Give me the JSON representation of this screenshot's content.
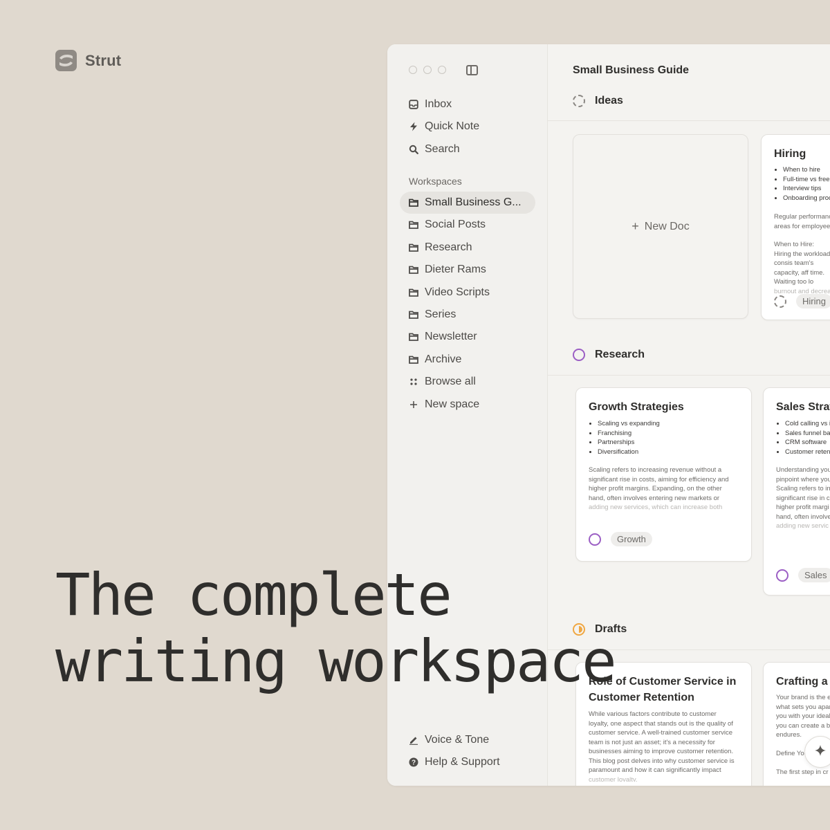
{
  "brand": {
    "name": "Strut"
  },
  "hero": {
    "line1": "The complete",
    "line2": "writing workspace"
  },
  "sidebar": {
    "top_items": [
      {
        "label": "Inbox",
        "icon": "inbox-icon"
      },
      {
        "label": "Quick Note",
        "icon": "bolt-icon"
      },
      {
        "label": "Search",
        "icon": "search-icon"
      }
    ],
    "section_label": "Workspaces",
    "workspaces": [
      {
        "label": "Small Business G...",
        "active": true
      },
      {
        "label": "Social Posts"
      },
      {
        "label": "Research"
      },
      {
        "label": "Dieter Rams"
      },
      {
        "label": "Video Scripts"
      },
      {
        "label": "Series"
      },
      {
        "label": "Newsletter"
      },
      {
        "label": "Archive"
      }
    ],
    "browse_all": "Browse all",
    "new_space": "New space",
    "bottom_items": [
      {
        "label": "Voice & Tone",
        "icon": "pen-icon"
      },
      {
        "label": "Help & Support",
        "icon": "help-icon"
      }
    ]
  },
  "main": {
    "title": "Small Business Guide",
    "groups": [
      {
        "label": "Ideas",
        "status": "dashed"
      },
      {
        "label": "Research",
        "status": "purple"
      },
      {
        "label": "Drafts",
        "status": "orange"
      }
    ],
    "new_doc": "New Doc",
    "cards": {
      "hiring": {
        "title": "Hiring",
        "bullets": [
          "When to hire",
          "Full-time vs free",
          "Interview tips",
          "Onboarding proc"
        ],
        "body1": "Regular performanc areas for employee",
        "body2": "When to Hire: Hiring the workload consis team's capacity, aff time. Waiting too lo",
        "faded": "burnout and decrea",
        "tag": "Hiring"
      },
      "growth": {
        "title": "Growth Strategies",
        "bullets": [
          "Scaling vs expanding",
          "Franchising",
          "Partnerships",
          "Diversification"
        ],
        "body": "Scaling refers to increasing revenue without a significant rise in costs, aiming for efficiency and higher profit margins. Expanding, on the other hand, often involves entering new markets or",
        "faded": "adding new services, which can increase both",
        "tag": "Growth"
      },
      "sales": {
        "title": "Sales Strat",
        "bullets": [
          "Cold calling vs i",
          "Sales funnel ba",
          "CRM software",
          "Customer reten"
        ],
        "body": "Understanding you pinpoint where you Scaling refers to in significant rise in c higher profit margi hand, often involve",
        "faded": "adding new servic",
        "tag": "Sales"
      },
      "customer": {
        "title": "Role of Customer Service in Customer Retention",
        "body": "While various factors contribute to customer loyalty, one aspect that stands out is the quality of customer service. A well-trained customer service team is not just an asset; it's a necessity for businesses aiming to improve customer retention. This blog post delves into why customer service is paramount and how it can significantly impact",
        "faded": "customer loyalty."
      },
      "crafting": {
        "title": "Crafting a",
        "body": "Your brand is the e what sets you apar you with your ideal you can create a b endures.",
        "body2": "Define You",
        "faded": "The first step in cr"
      }
    }
  }
}
